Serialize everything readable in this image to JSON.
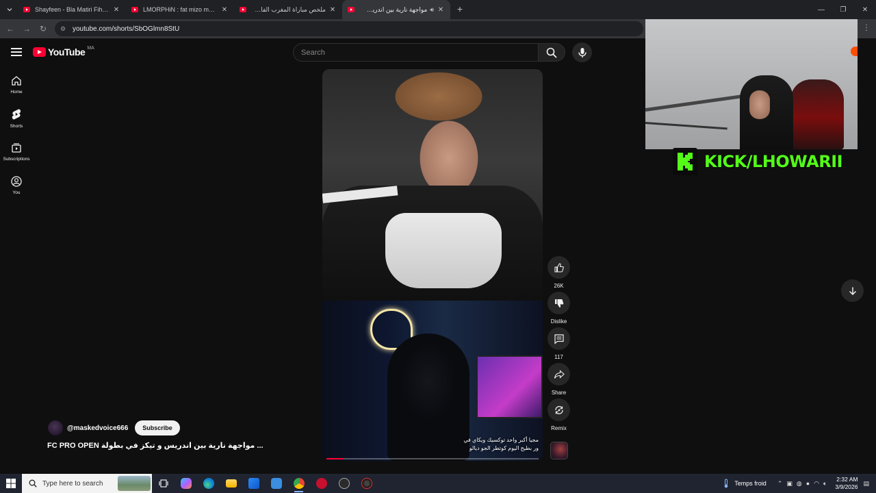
{
  "browser": {
    "tabs": [
      {
        "title": "Shayfeen - Bla Matiri Fihoum (",
        "active": false
      },
      {
        "title": "LMORPHiN : fat mizo mn lwlin",
        "active": false
      },
      {
        "title": "ملخص مباراة المغرب الفاسي ضد",
        "active": false
      },
      {
        "title": "مواجهة نارية بين اندريس و تي",
        "active": true,
        "audio": true
      }
    ],
    "url": "youtube.com/shorts/SbOGlmn8StU"
  },
  "youtube": {
    "logo_text": "YouTube",
    "region": "MA",
    "search_placeholder": "Search",
    "rail": [
      {
        "label": "Home",
        "icon": "home-icon"
      },
      {
        "label": "Shorts",
        "icon": "shorts-icon"
      },
      {
        "label": "Subscriptions",
        "icon": "subscriptions-icon"
      },
      {
        "label": "You",
        "icon": "you-icon"
      }
    ],
    "actions": {
      "like_count": "26K",
      "dislike_label": "Dislike",
      "comment_count": "117",
      "share_label": "Share",
      "remix_label": "Remix"
    },
    "channel": {
      "handle": "@maskedvoice666",
      "subscribe_label": "Subscribe"
    },
    "video_title": "FC PRO OPEN مواجهة نارية بين اندريس و تيكز في بطولة ...",
    "caption_lines": [
      "مجيا أكبر واحد توكسيك ويكاي في",
      "ور بطيح اليوم كوتطر الجو ديالو"
    ],
    "progress": 0.08
  },
  "overlay": {
    "kick_text": "KICK/LHOWARII",
    "kick_color": "#53fc18"
  },
  "taskbar": {
    "search_placeholder": "Type here to search",
    "weather": "Temps froid",
    "time": "2:32 AM",
    "date": "3/9/2026"
  }
}
